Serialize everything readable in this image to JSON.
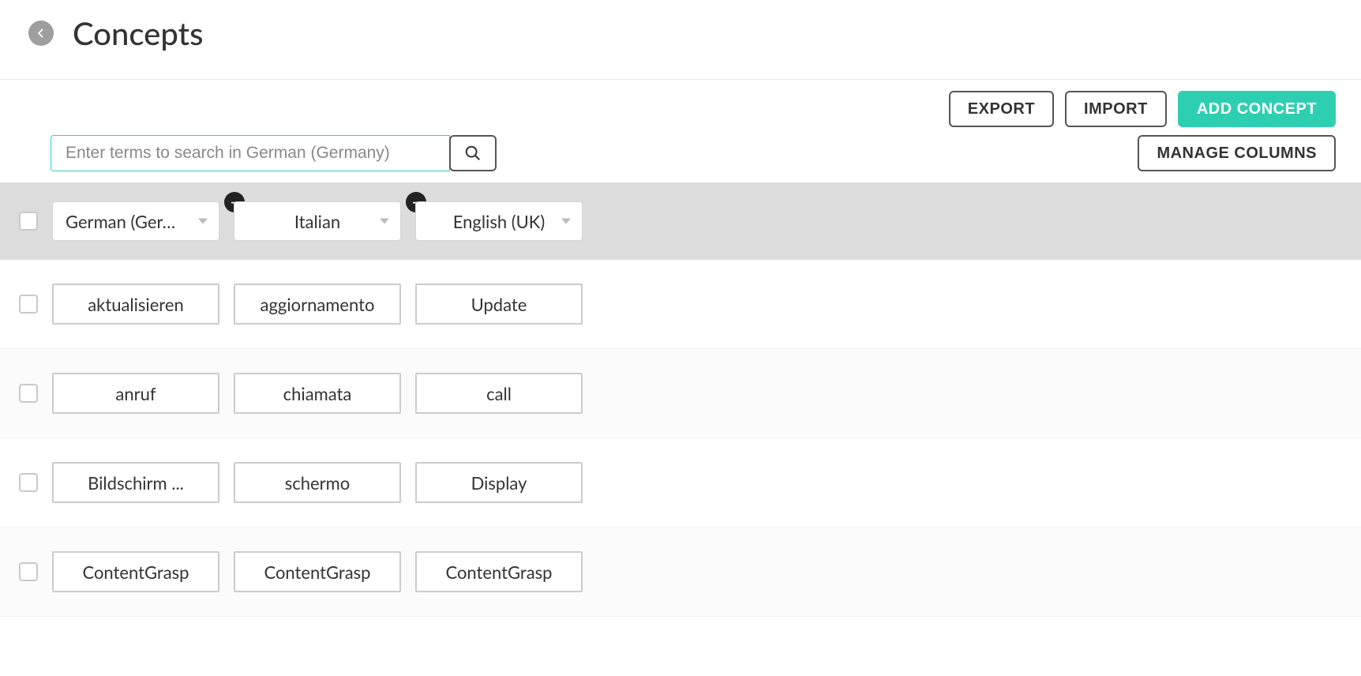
{
  "header": {
    "title": "Concepts"
  },
  "toolbar": {
    "search_placeholder": "Enter terms to search in German (Germany)",
    "buttons": {
      "export": "EXPORT",
      "import": "IMPORT",
      "add_concept": "ADD CONCEPT",
      "manage_columns": "MANAGE COLUMNS"
    }
  },
  "columns": [
    {
      "label": "German (Ger…",
      "removable": false
    },
    {
      "label": "Italian",
      "removable": true
    },
    {
      "label": "English (UK)",
      "removable": true
    }
  ],
  "rows": [
    {
      "cells": [
        "aktualisieren",
        "aggiornamento",
        "Update"
      ]
    },
    {
      "cells": [
        "anruf",
        "chiamata",
        "call"
      ]
    },
    {
      "cells": [
        "Bildschirm ...",
        "schermo",
        "Display"
      ]
    },
    {
      "cells": [
        "ContentGrasp",
        "ContentGrasp",
        "ContentGrasp"
      ]
    }
  ]
}
